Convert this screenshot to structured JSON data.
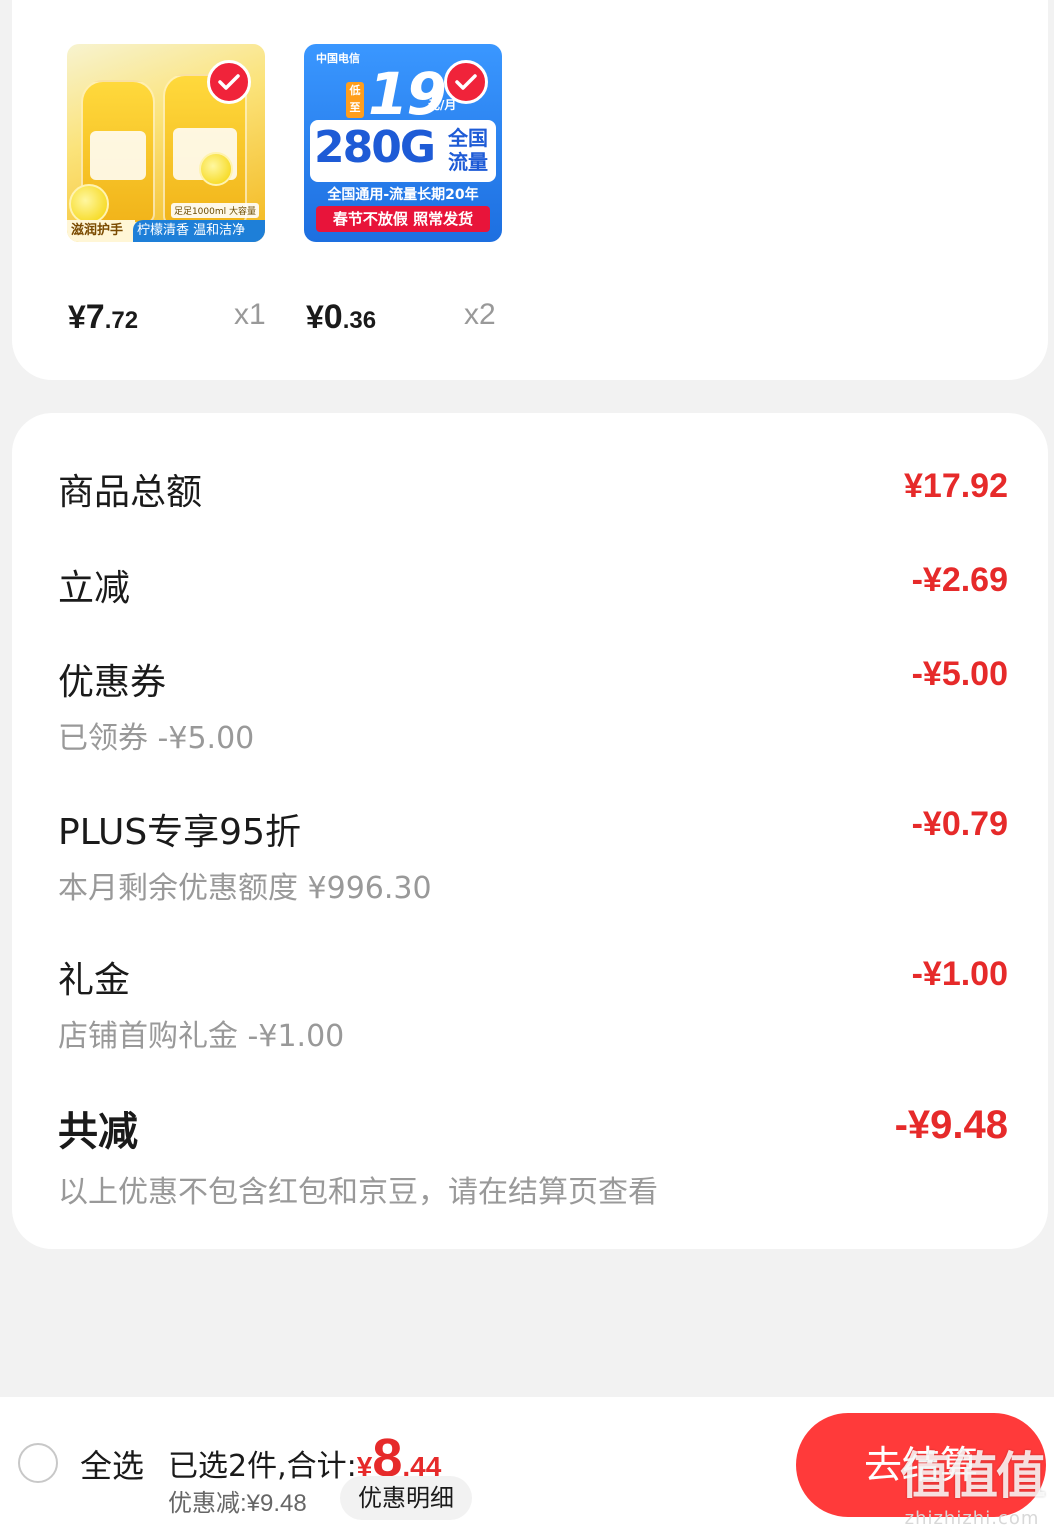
{
  "products": [
    {
      "name": "lemon-hand-wash",
      "selected": true,
      "thumb_text": {
        "tag_left": "滋润护手",
        "tag_right": "柠檬清香 温和洁净",
        "capacity": "足足1000ml 大容量"
      },
      "price": {
        "yen": "¥",
        "int": "7",
        "dec": ".72"
      },
      "qty": "x1"
    },
    {
      "name": "china-telecom-sim",
      "selected": true,
      "thumb_text": {
        "brand": "中国电信",
        "low": "低至",
        "price": "19",
        "unit": "元/月",
        "data": "280G",
        "data_label": "全国流量",
        "line1": "全国通用-流量长期20年",
        "line2": "春节不放假 照常发货"
      },
      "price": {
        "yen": "¥",
        "int": "0",
        "dec": ".36"
      },
      "qty": "x2"
    }
  ],
  "summary": {
    "goods_total": {
      "label": "商品总额",
      "amount": "¥17.92"
    },
    "instant_off": {
      "label": "立减",
      "amount": "-¥2.69"
    },
    "coupon": {
      "label": "优惠券",
      "amount": "-¥5.00",
      "sub": "已领券 -¥5.00"
    },
    "plus": {
      "label": "PLUS专享95折",
      "amount": "-¥0.79",
      "sub": "本月剩余优惠额度 ¥996.30"
    },
    "gift": {
      "label": "礼金",
      "amount": "-¥1.00",
      "sub": "店铺首购礼金 -¥1.00"
    },
    "total_off": {
      "label": "共减",
      "amount": "-¥9.48",
      "sub": "以上优惠不包含红包和京豆，请在结算页查看"
    }
  },
  "bottom_bar": {
    "select_all": "全选",
    "selected_prefix": "已选2件,合计:",
    "total": {
      "yen": "¥",
      "int": "8",
      "dec": ".44"
    },
    "discount": "优惠减:¥9.48",
    "detail_button": "优惠明细",
    "checkout_button": "去结算"
  },
  "watermark": {
    "logo": "值值值",
    "text": "zhizhizhi.com"
  },
  "colors": {
    "accent_red": "#e62a2a",
    "checkout_red": "#ff3a3a",
    "background": "#f2f2f2"
  }
}
